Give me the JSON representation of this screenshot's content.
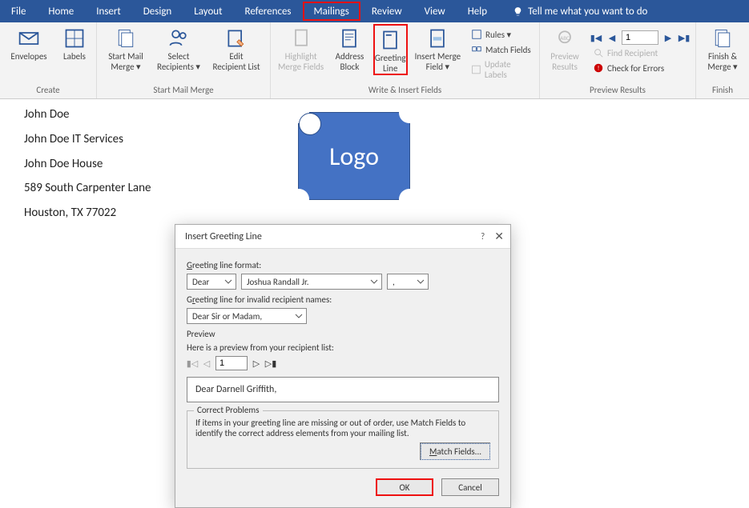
{
  "tabs": {
    "file": "File",
    "home": "Home",
    "insert": "Insert",
    "design": "Design",
    "layout": "Layout",
    "references": "References",
    "mailings": "Mailings",
    "review": "Review",
    "view": "View",
    "help": "Help",
    "tellme": "Tell me what you want to do"
  },
  "ribbon": {
    "create": {
      "label": "Create",
      "envelopes": "Envelopes",
      "labels": "Labels"
    },
    "start": {
      "label": "Start Mail Merge",
      "startmerge": "Start Mail\nMerge ▾",
      "select": "Select\nRecipients ▾",
      "edit": "Edit\nRecipient List"
    },
    "write": {
      "label": "Write & Insert Fields",
      "highlight": "Highlight\nMerge Fields",
      "address": "Address\nBlock",
      "greeting": "Greeting\nLine",
      "insertmerge": "Insert Merge\nField ▾",
      "rules": "Rules ▾",
      "match": "Match Fields",
      "update": "Update Labels"
    },
    "preview": {
      "label": "Preview Results",
      "preview": "Preview\nResults",
      "find": "Find Recipient",
      "check": "Check for Errors",
      "page": "1"
    },
    "finish": {
      "label": "Finish",
      "finish": "Finish &\nMerge ▾"
    }
  },
  "document": {
    "line1": "John Doe",
    "line2": "John Doe IT Services",
    "line3": "John Doe House",
    "line4": "589 South Carpenter Lane",
    "line5": "Houston, TX 77022",
    "logo": "Logo"
  },
  "dialog": {
    "title": "Insert Greeting Line",
    "format_label": "Greeting line format:",
    "salutation": "Dear",
    "name": "Joshua Randall Jr.",
    "punct": ",",
    "invalid_label": "Greeting line for invalid recipient names:",
    "invalid_value": "Dear Sir or Madam,",
    "preview_label": "Preview",
    "preview_hint": "Here is a preview from your recipient list:",
    "preview_page": "1",
    "preview_text": "Dear Darnell Griffith,",
    "correct_title": "Correct Problems",
    "correct_text": "If items in your greeting line are missing or out of order, use Match Fields to identify the correct address elements from your mailing list.",
    "match": "Match Fields...",
    "ok": "OK",
    "cancel": "Cancel"
  }
}
